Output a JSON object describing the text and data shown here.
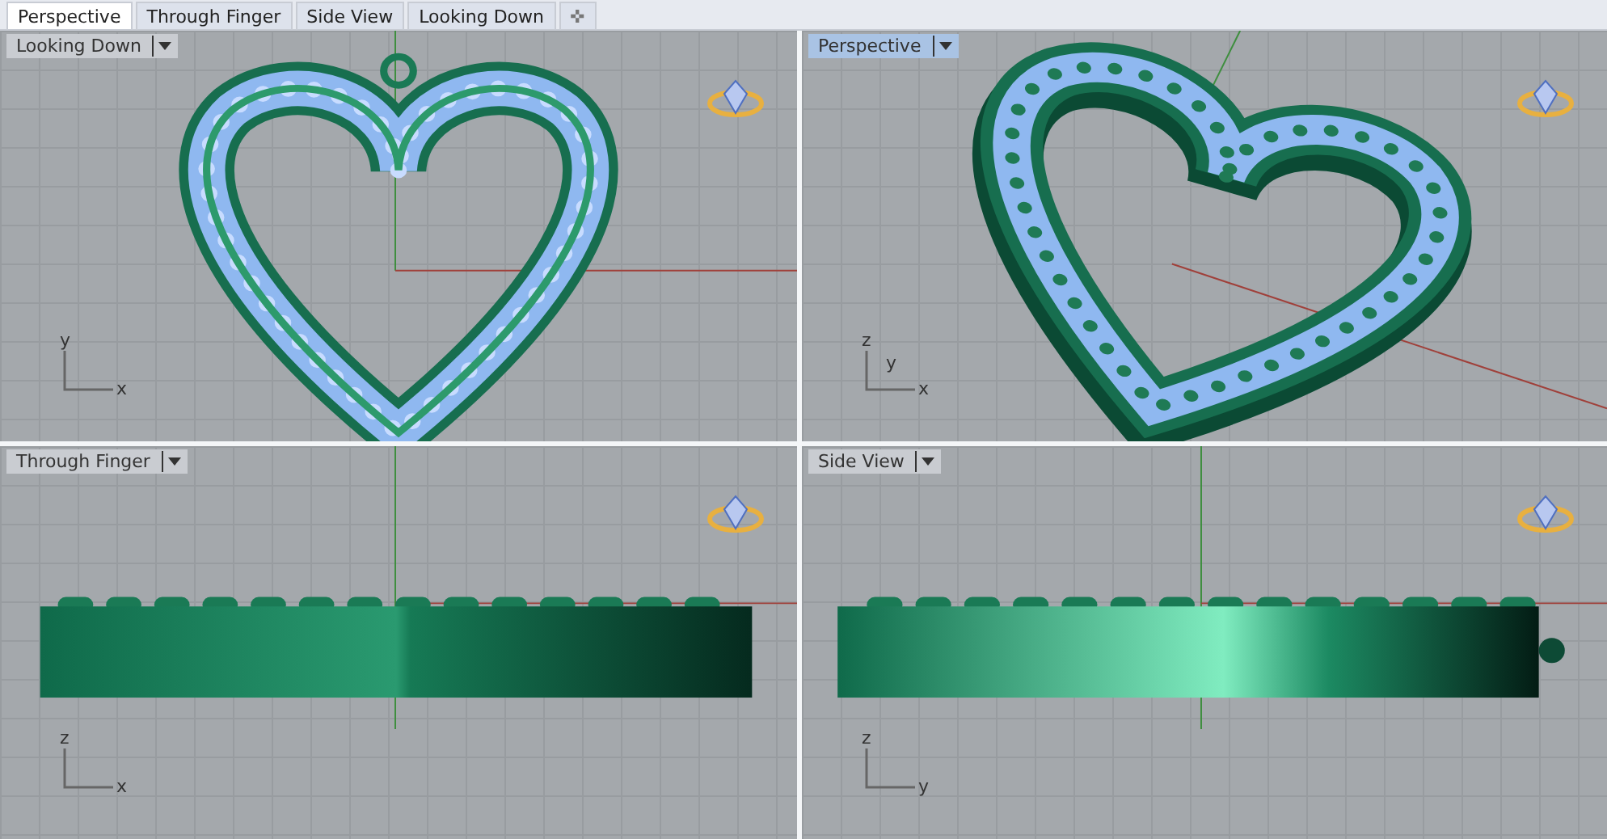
{
  "tabs": [
    {
      "label": "Perspective",
      "selected": true
    },
    {
      "label": "Through Finger",
      "selected": false
    },
    {
      "label": "Side View",
      "selected": false
    },
    {
      "label": "Looking Down",
      "selected": false
    }
  ],
  "add_tab": "✜",
  "viewports": [
    {
      "title": "Looking Down",
      "active": false,
      "kind": "top",
      "axes": [
        "y",
        "x"
      ]
    },
    {
      "title": "Perspective",
      "active": true,
      "kind": "perspective",
      "axes": [
        "z",
        "y",
        "x"
      ]
    },
    {
      "title": "Through Finger",
      "active": false,
      "kind": "front",
      "axes": [
        "z",
        "x"
      ]
    },
    {
      "title": "Side View",
      "active": false,
      "kind": "side",
      "axes": [
        "z",
        "y"
      ]
    }
  ]
}
